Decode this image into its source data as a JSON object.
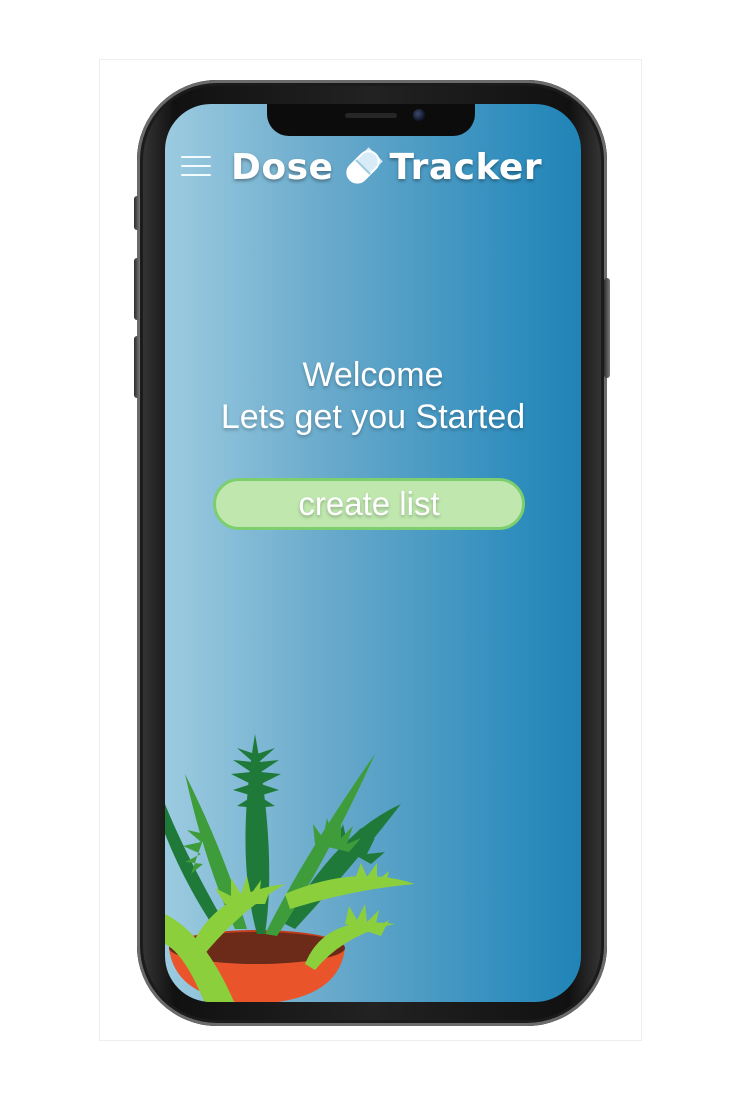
{
  "app": {
    "name_part1": "Dose",
    "name_part2": "Tracker",
    "logo_icon": "capsule-pill-icon"
  },
  "header": {
    "menu_icon": "hamburger-menu-icon"
  },
  "main": {
    "welcome_line1": "Welcome",
    "welcome_line2": "Lets get you Started",
    "create_button_label": "create list"
  },
  "decor": {
    "illustration": "potted-fern-plant"
  },
  "colors": {
    "background_gradient_start": "#9ccbe0",
    "background_gradient_end": "#1f84b6",
    "button_fill": "#bfe7ae",
    "button_border": "#7cce6e",
    "pot": "#e9542a"
  }
}
